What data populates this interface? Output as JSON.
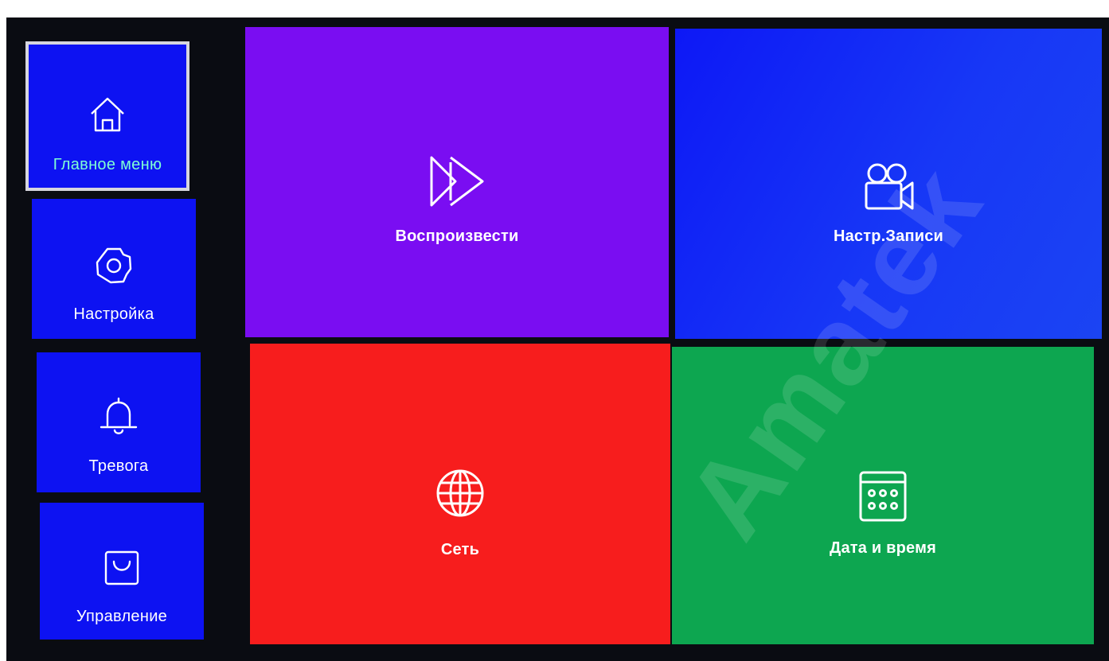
{
  "sidebar": {
    "items": [
      {
        "label": "Главное меню",
        "icon": "home-icon",
        "active": true
      },
      {
        "label": "Настройка",
        "icon": "gear-icon",
        "active": false
      },
      {
        "label": "Тревога",
        "icon": "bell-icon",
        "active": false
      },
      {
        "label": "Управление",
        "icon": "shopping-bag-icon",
        "active": false
      }
    ]
  },
  "tiles": {
    "playback": {
      "label": "Воспроизвести",
      "icon": "fast-forward-icon",
      "color": "#7a0df2"
    },
    "record_settings": {
      "label": "Настр.Записи",
      "icon": "video-camera-icon",
      "color": "#1737f6"
    },
    "network": {
      "label": "Сеть",
      "icon": "globe-icon",
      "color": "#f71d1d"
    },
    "date_time": {
      "label": "Дата и время",
      "icon": "calendar-icon",
      "color": "#0da650"
    }
  },
  "watermark": {
    "text": "Amatek"
  },
  "colors": {
    "background": "#0a0c12",
    "sidebar_item": "#0d12f2",
    "active_border": "#d6d6de",
    "active_label": "#7fffd4"
  }
}
